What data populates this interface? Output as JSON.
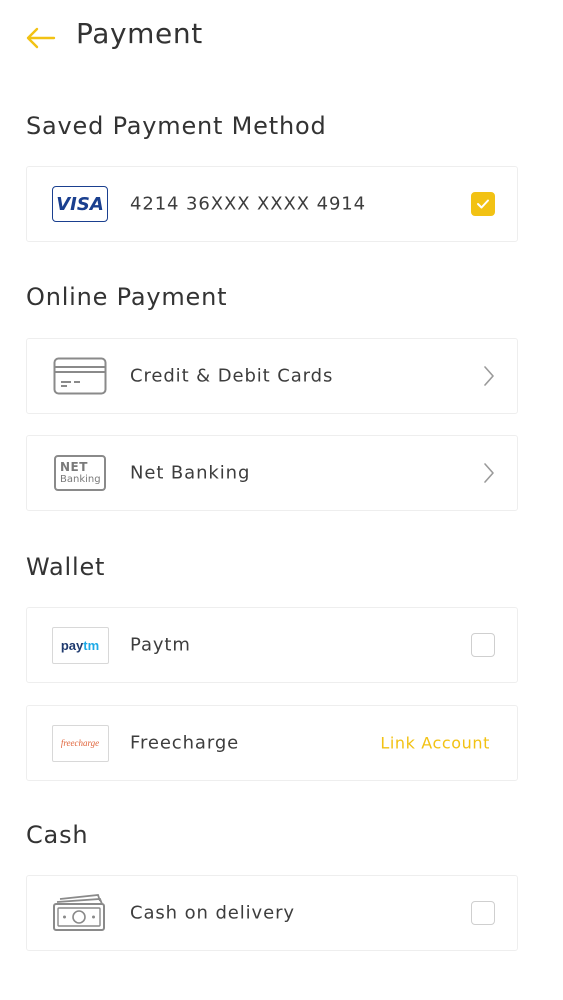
{
  "header": {
    "title": "Payment"
  },
  "sections": {
    "saved": {
      "title": "Saved Payment Method"
    },
    "online": {
      "title": "Online Payment"
    },
    "wallet": {
      "title": "Wallet"
    },
    "cash": {
      "title": "Cash"
    }
  },
  "saved_card": {
    "brand": "VISA",
    "number": "4214 36XXX XXXX 4914",
    "selected": true
  },
  "online_items": [
    {
      "label": "Credit & Debit Cards",
      "icon": "credit-card-icon"
    },
    {
      "label": "Net Banking",
      "icon": "net-banking-icon",
      "icon_line1": "NET",
      "icon_line2": "Banking"
    }
  ],
  "wallet_items": [
    {
      "label": "Paytm",
      "logo_part1": "pay",
      "logo_part2": "tm",
      "selected": false
    },
    {
      "label": "Freecharge",
      "logo_text": "freecharge",
      "action": "Link Account"
    }
  ],
  "cash_items": [
    {
      "label": "Cash on delivery",
      "icon": "banknote-icon",
      "selected": false
    }
  ],
  "colors": {
    "accent": "#f2c214",
    "visa": "#1a3f8f",
    "paytm_dark": "#1f3a6e",
    "paytm_light": "#1eaae7",
    "freecharge": "#e0643a"
  }
}
